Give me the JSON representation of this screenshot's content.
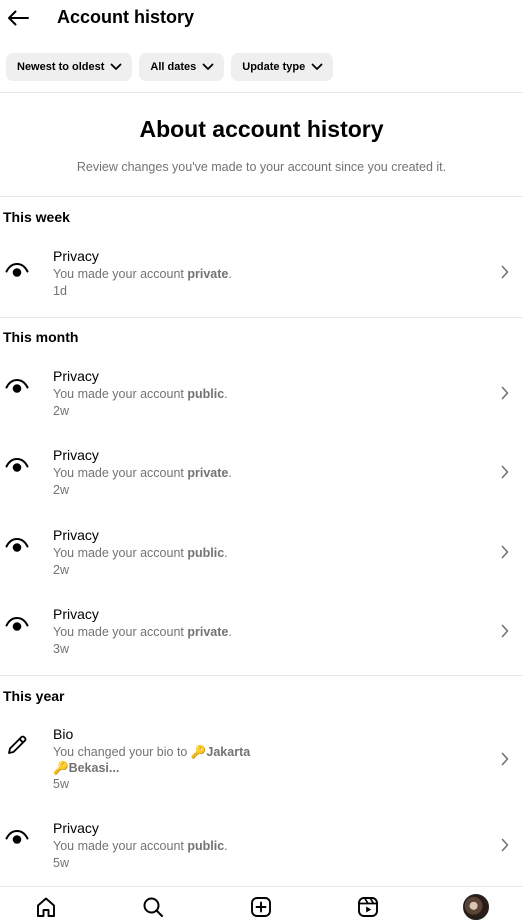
{
  "header": {
    "title": "Account history",
    "back_icon": "arrow-left-icon"
  },
  "filters": [
    {
      "label": "Newest to oldest",
      "icon": "chevron-down-icon"
    },
    {
      "label": "All dates",
      "icon": "chevron-down-icon"
    },
    {
      "label": "Update type",
      "icon": "chevron-down-icon"
    }
  ],
  "about": {
    "title": "About account history",
    "subtitle": "Review changes you've made to your account since you created it."
  },
  "sections": [
    {
      "title": "This week"
    },
    {
      "title": "This month"
    },
    {
      "title": "This year"
    }
  ],
  "items": [
    {
      "title": "Privacy",
      "desc_prefix": "You made your account ",
      "desc_bold": "private",
      "desc_suffix": ".",
      "time": "1d",
      "icon": "eye-icon"
    },
    {
      "title": "Privacy",
      "desc_prefix": "You made your account ",
      "desc_bold": "public",
      "desc_suffix": ".",
      "time": "2w",
      "icon": "eye-icon"
    },
    {
      "title": "Privacy",
      "desc_prefix": "You made your account ",
      "desc_bold": "private",
      "desc_suffix": ".",
      "time": "2w",
      "icon": "eye-icon"
    },
    {
      "title": "Privacy",
      "desc_prefix": "You made your account ",
      "desc_bold": "public",
      "desc_suffix": ".",
      "time": "2w",
      "icon": "eye-icon"
    },
    {
      "title": "Privacy",
      "desc_prefix": "You made your account ",
      "desc_bold": "private",
      "desc_suffix": ".",
      "time": "3w",
      "icon": "eye-icon"
    },
    {
      "title": "Bio",
      "desc_prefix": "You changed your bio to ",
      "desc_bold": "🔑Jakarta 🔑Bekasi...",
      "desc_suffix": "",
      "time": "5w",
      "icon": "pencil-icon"
    },
    {
      "title": "Privacy",
      "desc_prefix": "You made your account ",
      "desc_bold": "public",
      "desc_suffix": ".",
      "time": "5w",
      "icon": "eye-icon"
    }
  ],
  "bottom_nav": [
    {
      "name": "home",
      "icon": "home-icon"
    },
    {
      "name": "search",
      "icon": "search-icon"
    },
    {
      "name": "create",
      "icon": "plus-square-icon"
    },
    {
      "name": "reels",
      "icon": "reels-icon"
    },
    {
      "name": "profile",
      "icon": "avatar"
    }
  ]
}
